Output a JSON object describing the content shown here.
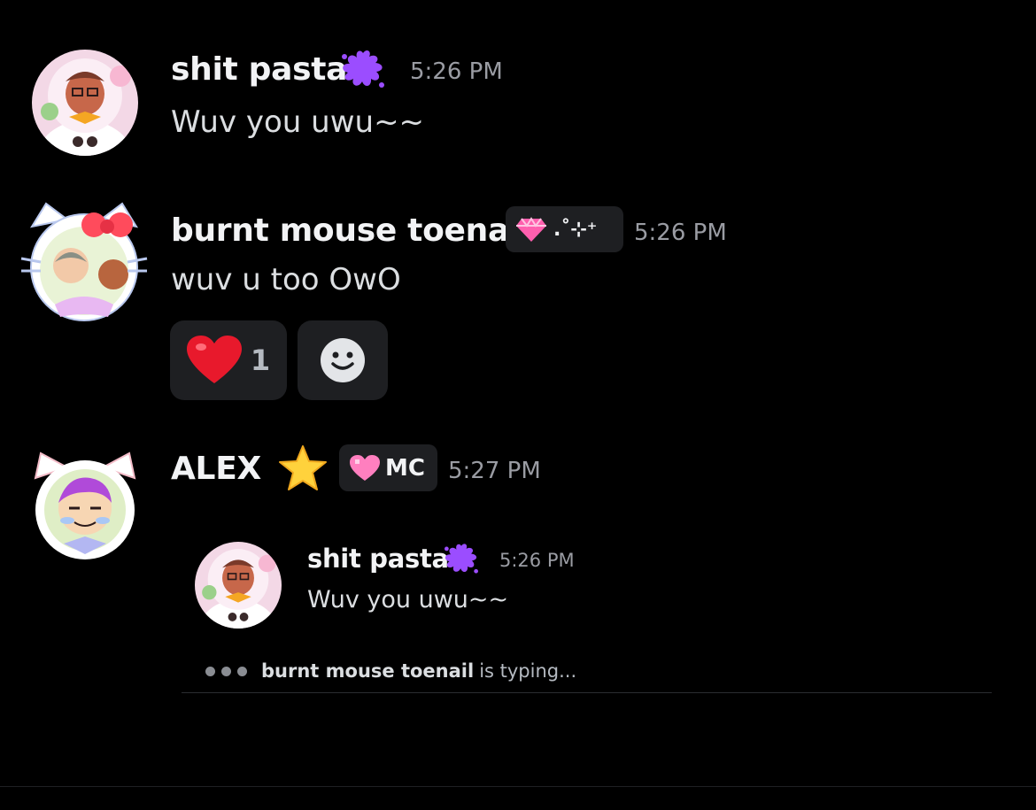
{
  "messages": [
    {
      "author": "shit pasta",
      "author_badge_icon": "purple-splat-icon",
      "timestamp": "5:26 PM",
      "content": "Wuv you uwu~~"
    },
    {
      "author": "burnt mouse toenail",
      "tag_icon": "pink-gem-icon",
      "tag_text": ".˚⊹⁺",
      "timestamp": "5:26 PM",
      "content": "wuv u too OwO",
      "reactions": [
        {
          "emoji": "❤️",
          "icon": "red-heart-icon",
          "count": "1"
        }
      ],
      "add_reaction_icon": "add-reaction-smiley-icon"
    },
    {
      "author": "ALEX",
      "author_badge_icon": "star-icon",
      "tag_icon": "pink-heart-icon",
      "tag_text": "MC",
      "timestamp": "5:27 PM",
      "embed": {
        "author": "shit pasta",
        "author_badge_icon": "purple-splat-icon",
        "timestamp": "5:26 PM",
        "content": "Wuv you uwu~~"
      }
    }
  ],
  "typing_indicator": {
    "user": "burnt mouse toenail",
    "suffix": "is typing..."
  },
  "colors": {
    "background": "#000000",
    "username": "#f2f3f5",
    "message_text": "#dbdee1",
    "timestamp": "#9a9ca3",
    "pill_background": "#1e1f22",
    "splat_purple": "#9b4dff",
    "heart_red": "#e8192c",
    "star_yellow": "#ffd23c"
  }
}
